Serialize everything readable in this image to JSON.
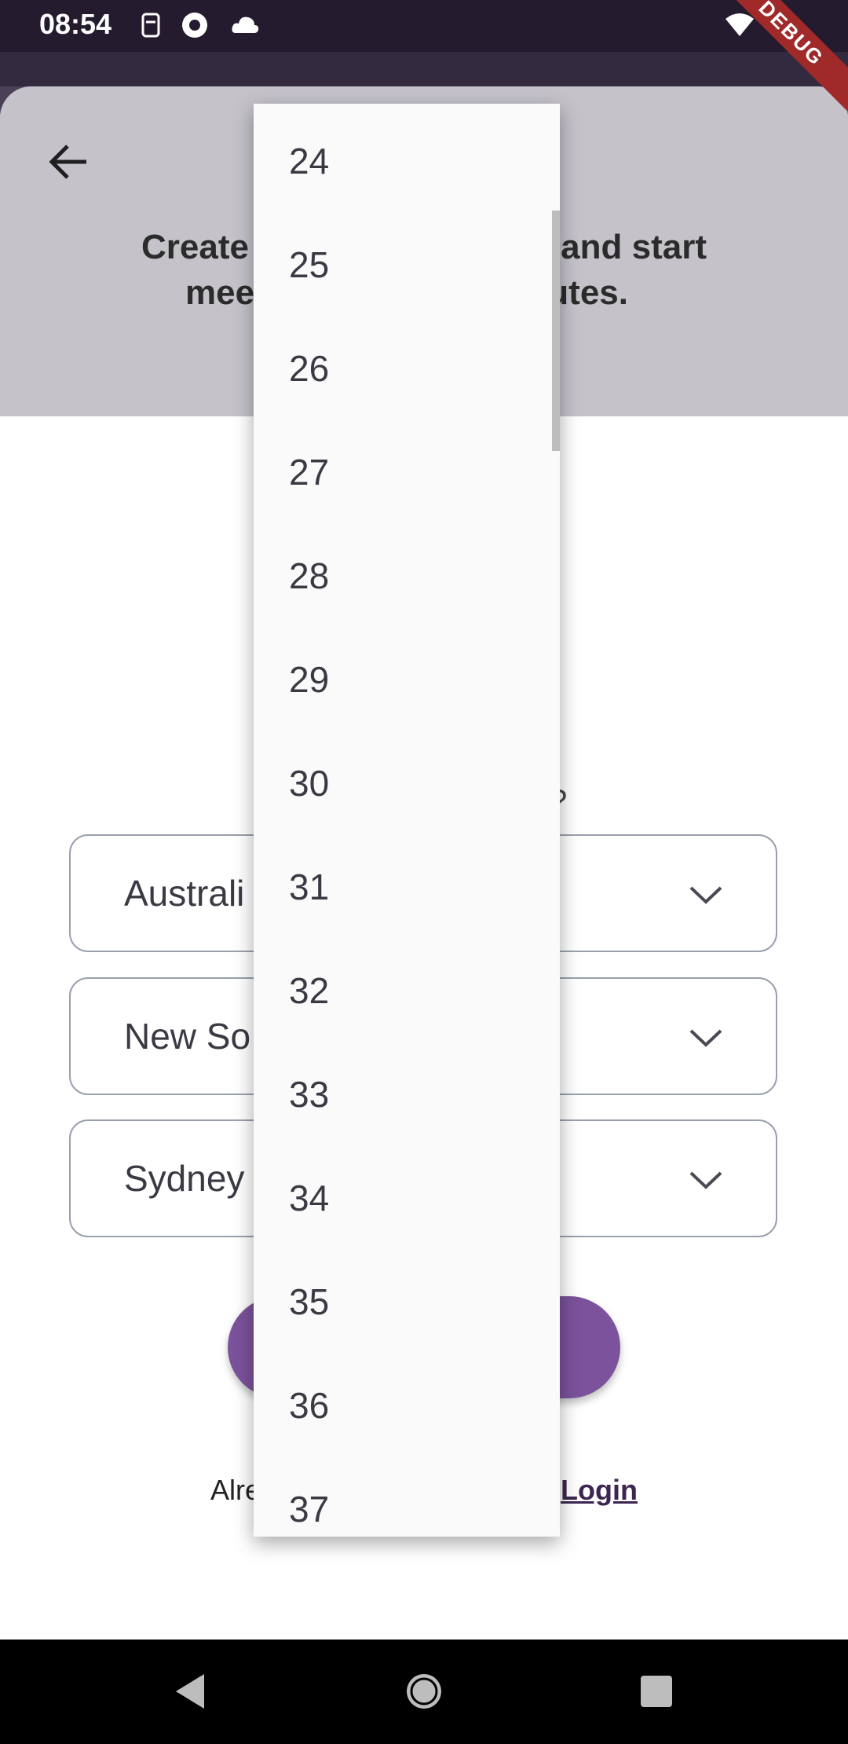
{
  "status_bar": {
    "time": "08:54",
    "icons": [
      "sim-icon",
      "sync-icon",
      "cloud-icon",
      "wifi-icon",
      "battery-icon"
    ]
  },
  "debug_banner": "DEBUG",
  "header": {
    "back_icon": "arrow-left-icon",
    "line1_left": "Create",
    "line1_right": "and start",
    "line2_left": "mee",
    "line2_right": "nutes."
  },
  "form": {
    "country_value": "Australi",
    "state_value": "New So",
    "city_value": "Sydney",
    "chevron_icon": "chevron-down-icon",
    "bg_fragment": "?"
  },
  "footer": {
    "prompt": "Alre",
    "login_label": "Login"
  },
  "dropdown": {
    "options": [
      "24",
      "25",
      "26",
      "27",
      "28",
      "29",
      "30",
      "31",
      "32",
      "33",
      "34",
      "35",
      "36",
      "37"
    ]
  },
  "nav_bar": {
    "back_icon": "nav-back-icon",
    "home_icon": "nav-home-icon",
    "recents_icon": "nav-recents-icon"
  }
}
